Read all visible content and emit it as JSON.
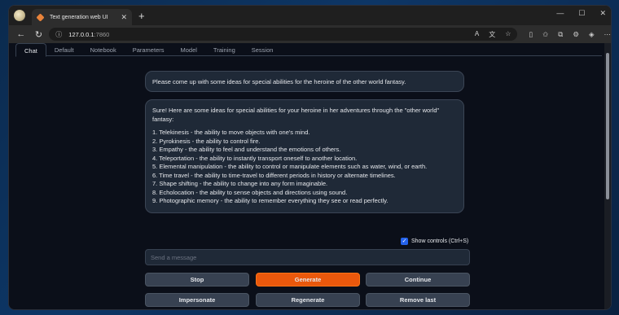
{
  "browser": {
    "tab_title": "Text generation web UI",
    "tab_close": "✕",
    "new_tab": "+",
    "url_host": "127.0.0.1",
    "url_port": ":7860",
    "window_controls": {
      "minimize": "—",
      "maximize": "☐",
      "close": "✕"
    }
  },
  "app": {
    "tabs": [
      "Chat",
      "Default",
      "Notebook",
      "Parameters",
      "Model",
      "Training",
      "Session"
    ],
    "active_tab": "Chat"
  },
  "chat": {
    "user_message": "Please come up with some ideas for special abilities for the heroine of the other world fantasy.",
    "bot_intro": "Sure! Here are some ideas for special abilities for your heroine in her adventures through the \"other world\" fantasy:",
    "bot_items": [
      "1. Telekinesis - the ability to move objects with one's mind.",
      "2. Pyrokinesis - the ability to control fire.",
      "3. Empathy - the ability to feel and understand the emotions of others.",
      "4. Teleportation - the ability to instantly transport oneself to another location.",
      "5. Elemental manipulation - the ability to control or manipulate elements such as water, wind, or earth.",
      "6. Time travel - the ability to time-travel to different periods in history or alternate timelines.",
      "7. Shape shifting - the ability to change into any form imaginable.",
      "8. Echolocation - the ability to sense objects and directions using sound.",
      "9. Photographic memory - the ability to remember everything they see or read perfectly."
    ],
    "show_controls_label": "Show controls (Ctrl+S)",
    "show_controls_checked": true,
    "input_placeholder": "Send a message"
  },
  "buttons": {
    "stop": "Stop",
    "generate": "Generate",
    "continue": "Continue",
    "impersonate": "Impersonate",
    "regenerate": "Regenerate",
    "remove_last": "Remove last"
  },
  "colors": {
    "accent": "#ea580c",
    "checkbox": "#2563eb",
    "background": "#0b0f19"
  }
}
